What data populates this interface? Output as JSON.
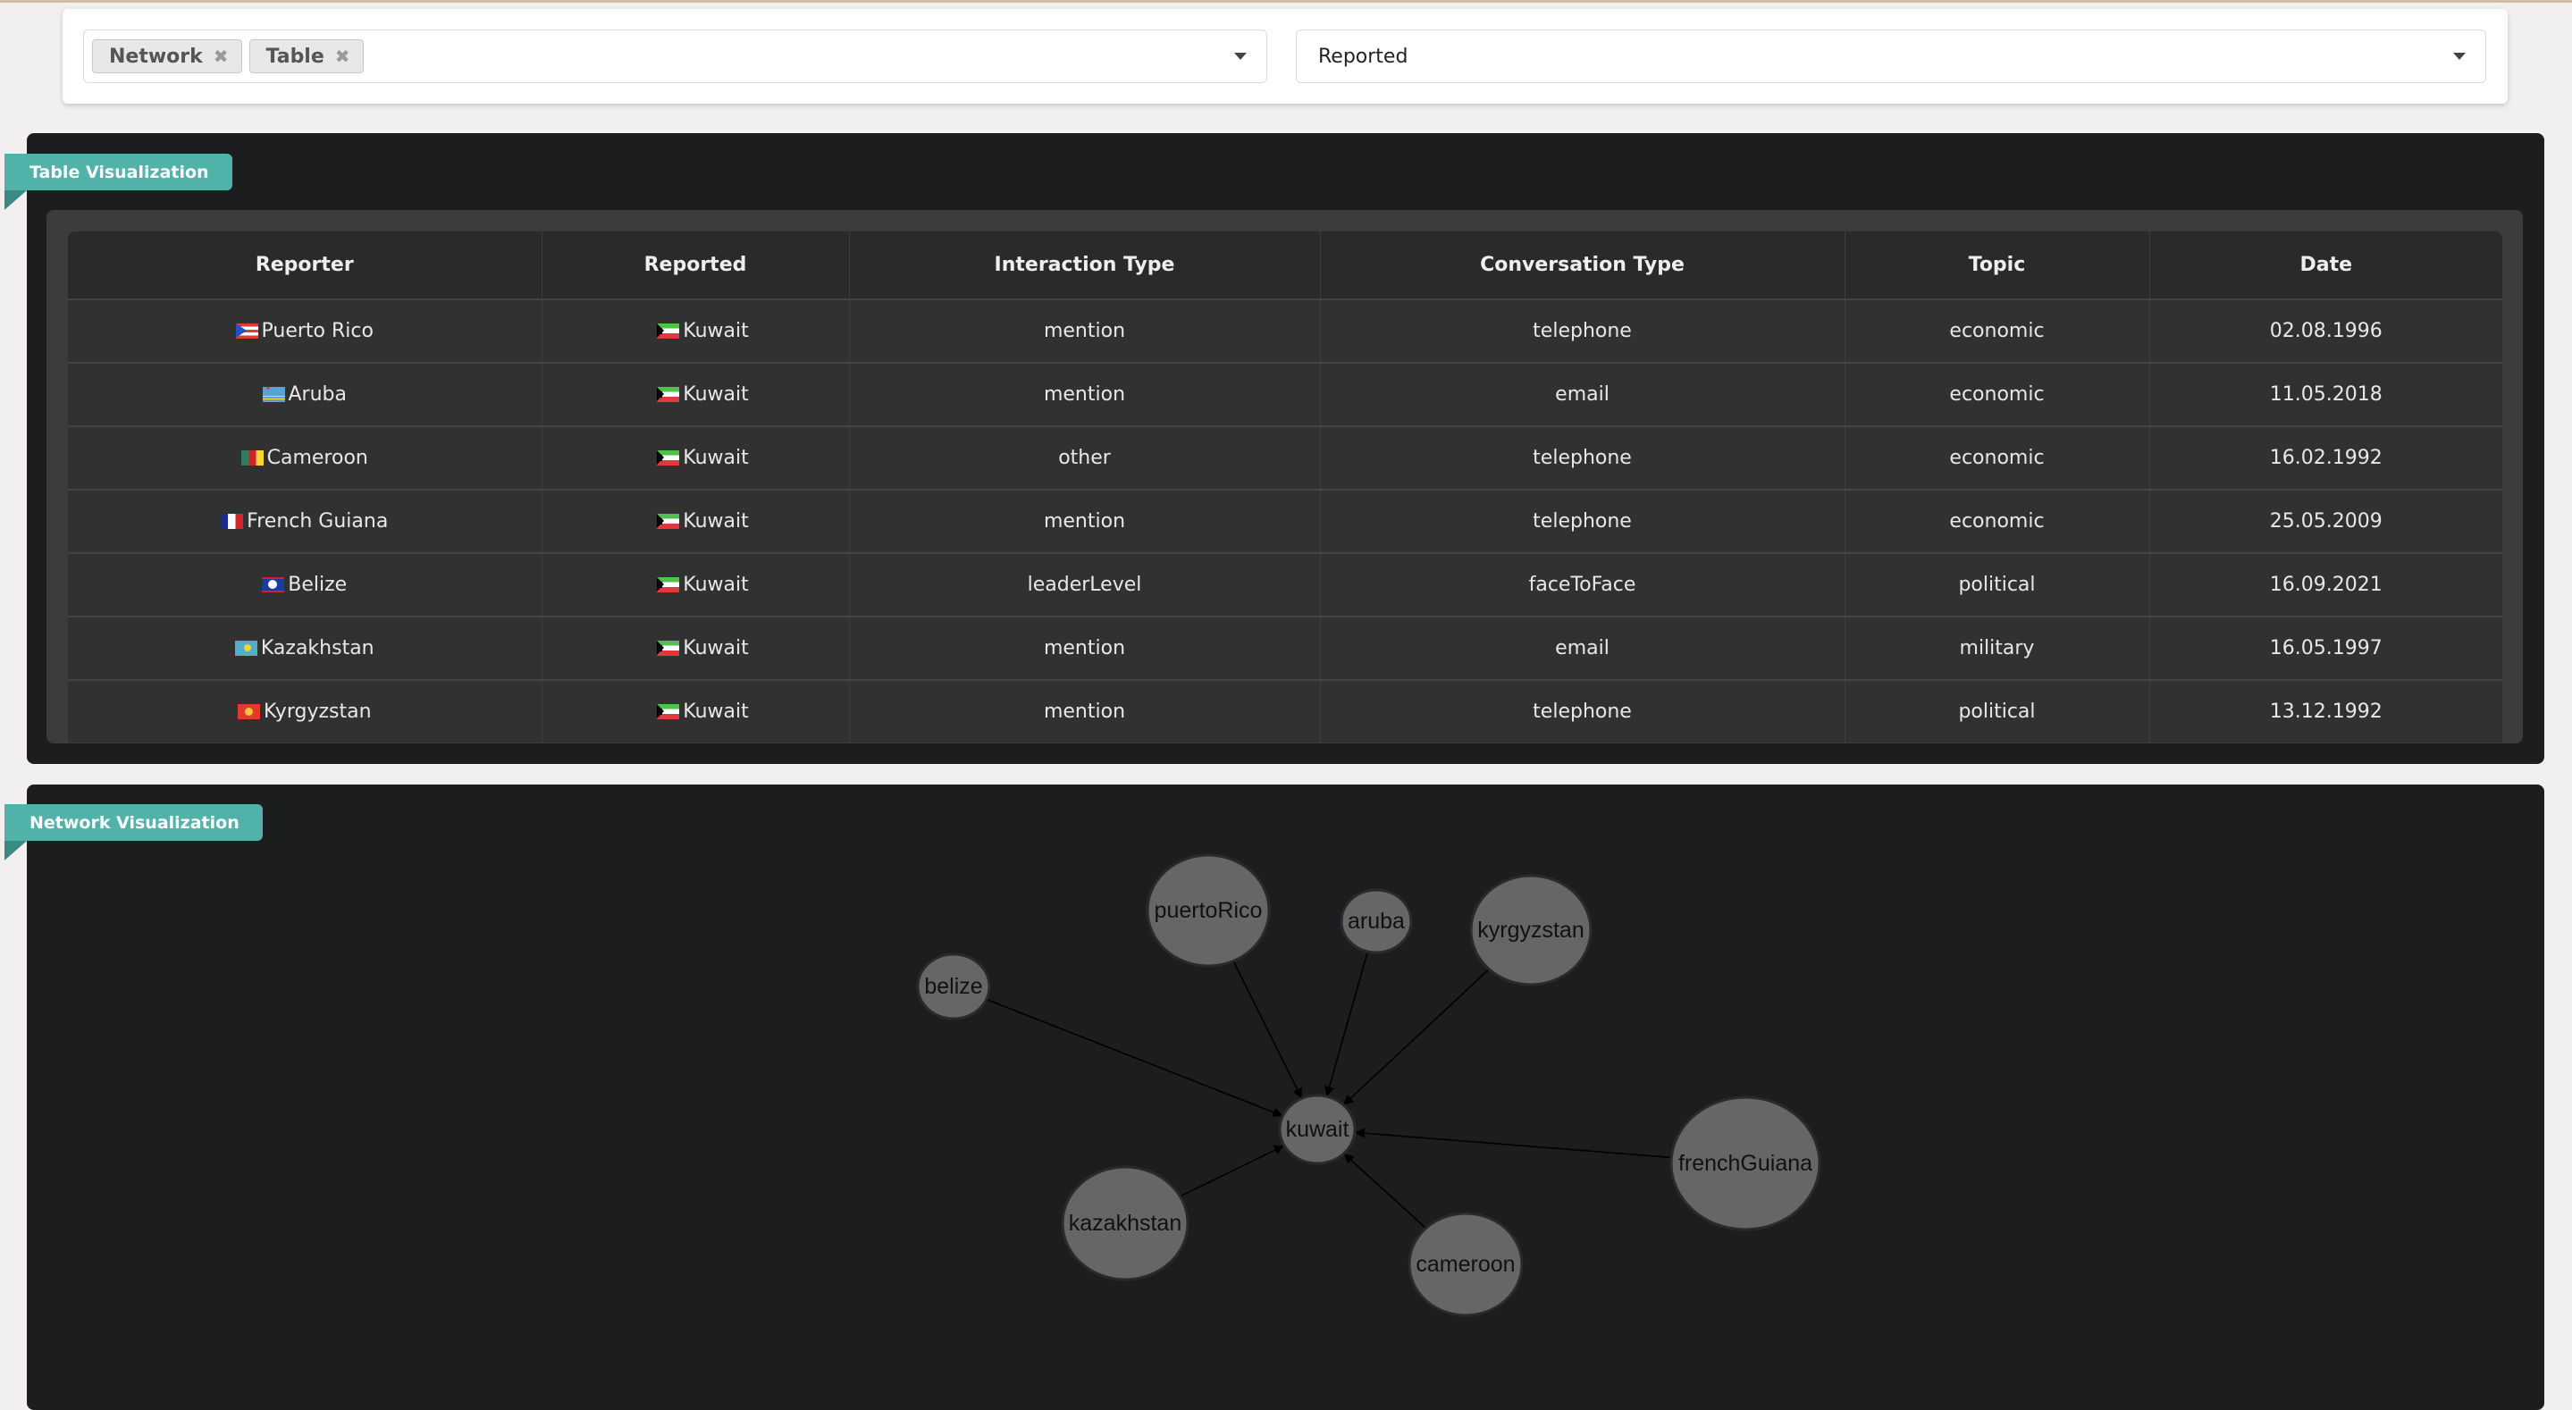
{
  "filters": {
    "views": {
      "selected": [
        "Network",
        "Table"
      ]
    },
    "node_type": {
      "selected": "Reported"
    }
  },
  "table_panel": {
    "title": "Table Visualization",
    "columns": [
      "Reporter",
      "Reported",
      "Interaction Type",
      "Conversation Type",
      "Topic",
      "Date"
    ],
    "rows": [
      {
        "reporter": "Puerto Rico",
        "reporter_flag": "pr",
        "reported": "Kuwait",
        "reported_flag": "kw",
        "interaction": "mention",
        "conversation": "telephone",
        "topic": "economic",
        "date": "02.08.1996"
      },
      {
        "reporter": "Aruba",
        "reporter_flag": "aw",
        "reported": "Kuwait",
        "reported_flag": "kw",
        "interaction": "mention",
        "conversation": "email",
        "topic": "economic",
        "date": "11.05.2018"
      },
      {
        "reporter": "Cameroon",
        "reporter_flag": "cm",
        "reported": "Kuwait",
        "reported_flag": "kw",
        "interaction": "other",
        "conversation": "telephone",
        "topic": "economic",
        "date": "16.02.1992"
      },
      {
        "reporter": "French Guiana",
        "reporter_flag": "gf",
        "reported": "Kuwait",
        "reported_flag": "kw",
        "interaction": "mention",
        "conversation": "telephone",
        "topic": "economic",
        "date": "25.05.2009"
      },
      {
        "reporter": "Belize",
        "reporter_flag": "bz",
        "reported": "Kuwait",
        "reported_flag": "kw",
        "interaction": "leaderLevel",
        "conversation": "faceToFace",
        "topic": "political",
        "date": "16.09.2021"
      },
      {
        "reporter": "Kazakhstan",
        "reporter_flag": "kz",
        "reported": "Kuwait",
        "reported_flag": "kw",
        "interaction": "mention",
        "conversation": "email",
        "topic": "military",
        "date": "16.05.1997"
      },
      {
        "reporter": "Kyrgyzstan",
        "reporter_flag": "kg",
        "reported": "Kuwait",
        "reported_flag": "kw",
        "interaction": "mention",
        "conversation": "telephone",
        "topic": "political",
        "date": "13.12.1992"
      }
    ]
  },
  "network_panel": {
    "title": "Network Visualization",
    "nodes": [
      "kuwait",
      "puertoRico",
      "aruba",
      "kyrgyzstan",
      "belize",
      "frenchGuiana",
      "kazakhstan",
      "cameroon"
    ],
    "edges": [
      {
        "from": "puertoRico",
        "to": "kuwait"
      },
      {
        "from": "aruba",
        "to": "kuwait"
      },
      {
        "from": "kyrgyzstan",
        "to": "kuwait"
      },
      {
        "from": "belize",
        "to": "kuwait"
      },
      {
        "from": "frenchGuiana",
        "to": "kuwait"
      },
      {
        "from": "kazakhstan",
        "to": "kuwait"
      },
      {
        "from": "cameroon",
        "to": "kuwait"
      }
    ]
  },
  "colors": {
    "accent": "#51b2aa",
    "panel_bg": "#1c1d1f",
    "node_fill": "#666666"
  }
}
